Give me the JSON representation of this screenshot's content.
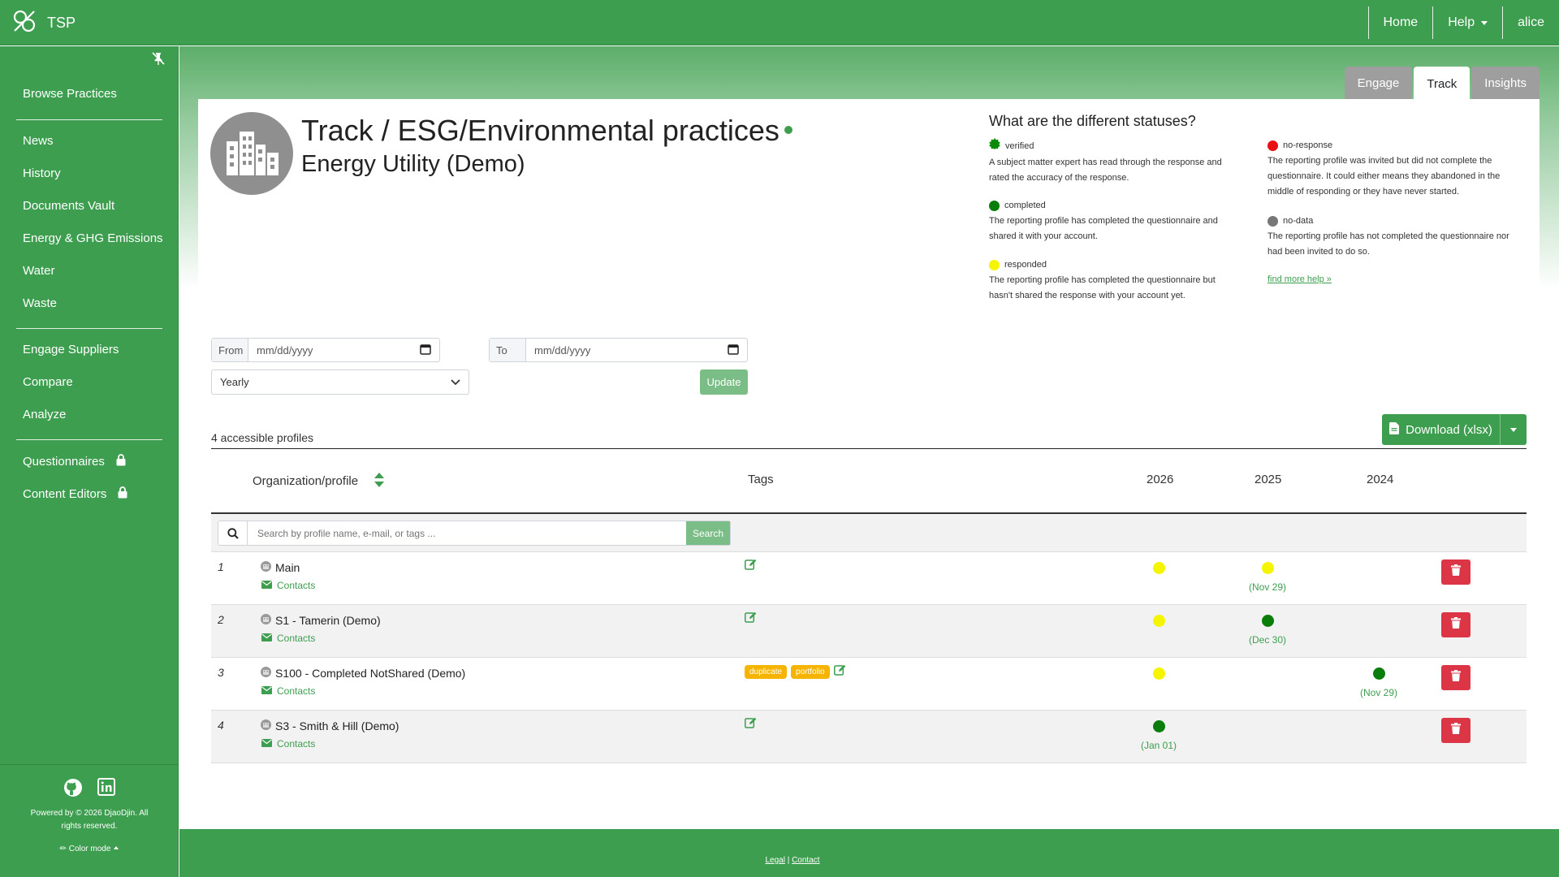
{
  "app": {
    "brand": "TSP"
  },
  "topnav": {
    "home": "Home",
    "help": "Help",
    "user": "alice"
  },
  "sidebar": {
    "items": [
      {
        "label": "Browse Practices"
      },
      {
        "label": "News"
      },
      {
        "label": "History"
      },
      {
        "label": "Documents Vault"
      },
      {
        "label": "Energy & GHG Emissions"
      },
      {
        "label": "Water"
      },
      {
        "label": "Waste"
      },
      {
        "label": "Engage Suppliers"
      },
      {
        "label": "Compare"
      },
      {
        "label": "Analyze"
      },
      {
        "label": "Questionnaires"
      },
      {
        "label": "Content Editors"
      }
    ],
    "powered": "Powered by © 2026 DjaoDjin. All rights reserved.",
    "color_mode": "Color mode"
  },
  "tabs": [
    {
      "label": "Engage"
    },
    {
      "label": "Track"
    },
    {
      "label": "Insights"
    }
  ],
  "page": {
    "title": "Track / ESG/Environmental practices",
    "subtitle": "Energy Utility (Demo)"
  },
  "statuses": {
    "title": "What are the different statuses?",
    "items": [
      {
        "name": "verified",
        "color": "#0a8a0a",
        "desc": "A subject matter expert has read through the response and rated the accuracy of the response."
      },
      {
        "name": "completed",
        "color": "#0a7d0a",
        "desc": "The reporting profile has completed the questionnaire and shared it with your account."
      },
      {
        "name": "responded",
        "color": "#f5f500",
        "desc": "The reporting profile has completed the questionnaire but hasn't shared the response with your account yet."
      },
      {
        "name": "no-response",
        "color": "#e81010",
        "desc": "The reporting profile was invited but did not complete the questionnaire. It could either means they abandoned in the middle of responding or they have never started."
      },
      {
        "name": "no-data",
        "color": "#777777",
        "desc": "The reporting profile has not completed the questionnaire nor had been invited to do so."
      }
    ],
    "find_help": "find more help »"
  },
  "filters": {
    "from_label": "From",
    "to_label": "To",
    "date_placeholder": "mm/dd/yyyy",
    "period": "Yearly",
    "update": "Update"
  },
  "profiles": {
    "count": "4 accessible profiles",
    "download": "Download (xlsx)",
    "headers": {
      "org": "Organization/profile",
      "tags": "Tags",
      "y1": "2026",
      "y2": "2025",
      "y3": "2024"
    },
    "search_placeholder": "Search by profile name, e-mail, or tags ...",
    "search_button": "Search",
    "contacts_label": "Contacts",
    "rows": [
      {
        "num": "1",
        "name": "Main",
        "tags": [],
        "y2026": {
          "status": "responded",
          "date": ""
        },
        "y2025": {
          "status": "responded",
          "date": "(Nov 29)"
        },
        "y2024": null
      },
      {
        "num": "2",
        "name": "S1 - Tamerin (Demo)",
        "tags": [],
        "y2026": {
          "status": "responded",
          "date": ""
        },
        "y2025": {
          "status": "completed",
          "date": "(Dec 30)"
        },
        "y2024": null
      },
      {
        "num": "3",
        "name": "S100 - Completed NotShared (Demo)",
        "tags": [
          "duplicate",
          "portfolio"
        ],
        "y2026": {
          "status": "responded",
          "date": ""
        },
        "y2025": null,
        "y2024": {
          "status": "completed",
          "date": "(Nov 29)"
        }
      },
      {
        "num": "4",
        "name": "S3 - Smith & Hill (Demo)",
        "tags": [],
        "y2026": {
          "status": "completed",
          "date": "(Jan 01)"
        },
        "y2025": null,
        "y2024": null
      }
    ]
  },
  "footer": {
    "legal": "Legal",
    "contact": "Contact"
  },
  "colors": {
    "brand": "#3d9e4f",
    "danger": "#dc3545",
    "responded": "#f5f500",
    "completed": "#0a7d0a"
  }
}
